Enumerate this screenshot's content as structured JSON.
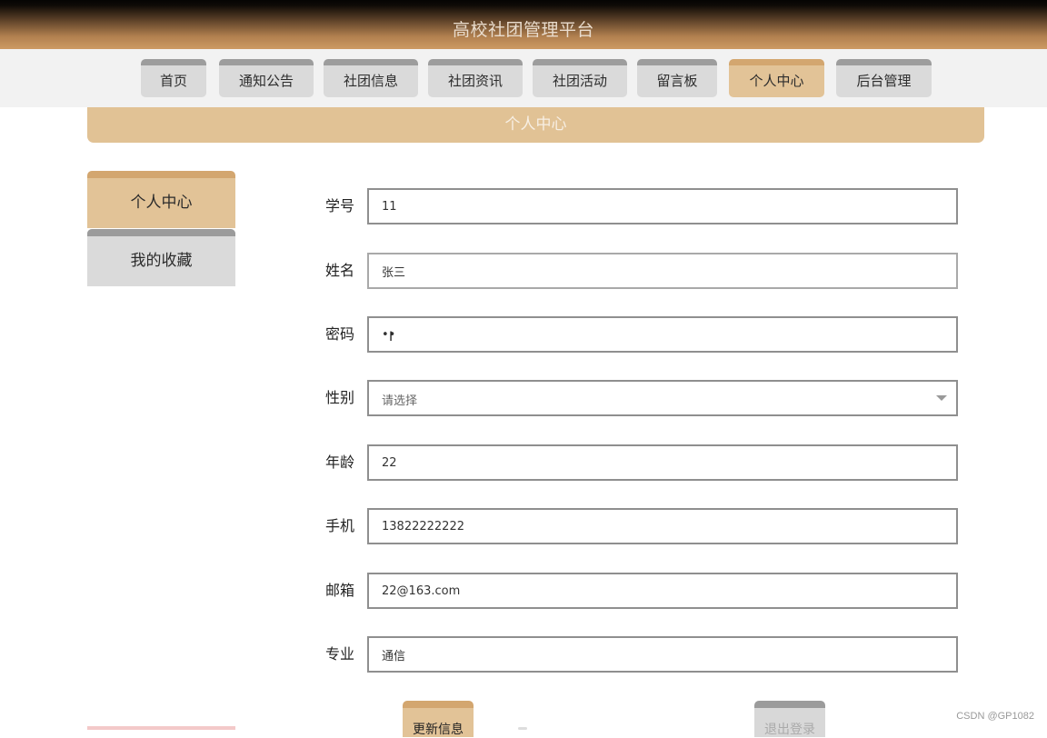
{
  "header": {
    "title": "高校社团管理平台"
  },
  "nav": {
    "items": [
      {
        "label": "首页"
      },
      {
        "label": "通知公告"
      },
      {
        "label": "社团信息"
      },
      {
        "label": "社团资讯"
      },
      {
        "label": "社团活动"
      },
      {
        "label": "留言板"
      },
      {
        "label": "个人中心",
        "active": true
      },
      {
        "label": "后台管理"
      }
    ]
  },
  "banner": {
    "title": "个人中心"
  },
  "sidebar": {
    "items": [
      {
        "label": "个人中心",
        "active": true
      },
      {
        "label": "我的收藏"
      }
    ]
  },
  "form": {
    "student_id": {
      "label": "学号",
      "value": "11"
    },
    "name": {
      "label": "姓名",
      "value": "张三"
    },
    "password": {
      "label": "密码",
      "value": "11"
    },
    "gender": {
      "label": "性别",
      "placeholder": "请选择"
    },
    "age": {
      "label": "年龄",
      "value": "22"
    },
    "phone": {
      "label": "手机",
      "value": "13822222222"
    },
    "email": {
      "label": "邮箱",
      "value": "22@163.com"
    },
    "major": {
      "label": "专业",
      "value": "通信"
    }
  },
  "actions": {
    "update_label": "更新信息",
    "logout_label": "退出登录"
  },
  "watermark": "CSDN @GP1082",
  "colors": {
    "accent": "#e2c397",
    "accent_dark": "#d3a66f",
    "inactive": "#dadada",
    "inactive_border": "#9d9d9d"
  }
}
